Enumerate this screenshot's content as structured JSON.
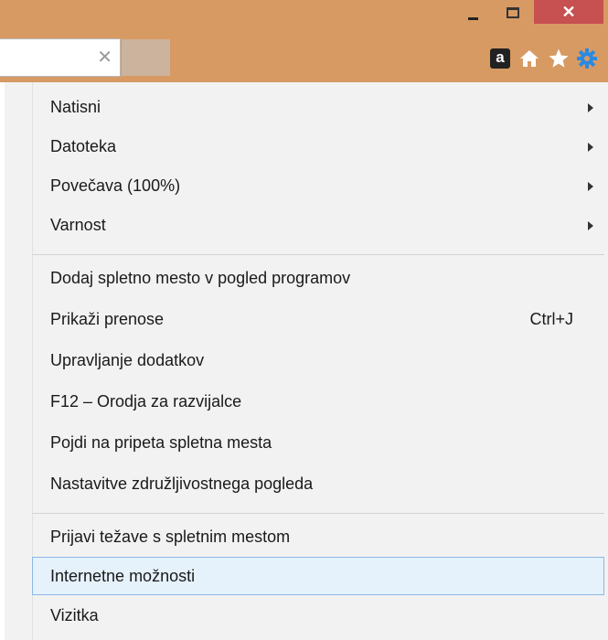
{
  "window": {
    "close_glyph": "✕"
  },
  "toolbar": {
    "clear_glyph": "✕",
    "amazon_glyph": "a",
    "accent_color": "#d79a63",
    "tab_color": "#cbb39e",
    "gear_color": "#2a8ae2"
  },
  "menu": {
    "items": [
      {
        "label": "Natisni",
        "submenu": true
      },
      {
        "label": "Datoteka",
        "submenu": true
      },
      {
        "label": "Povečava (100%)",
        "submenu": true
      },
      {
        "label": "Varnost",
        "submenu": true
      },
      {
        "label": "Dodaj spletno mesto v pogled programov"
      },
      {
        "label": "Prikaži prenose",
        "shortcut": "Ctrl+J"
      },
      {
        "label": "Upravljanje dodatkov"
      },
      {
        "label": "F12 – Orodja za razvijalce"
      },
      {
        "label": "Pojdi na pripeta spletna mesta"
      },
      {
        "label": "Nastavitve združljivostnega pogleda"
      },
      {
        "label": "Prijavi težave s spletnim mestom"
      },
      {
        "label": "Internetne možnosti",
        "selected": true
      },
      {
        "label": "Vizitka"
      }
    ]
  }
}
